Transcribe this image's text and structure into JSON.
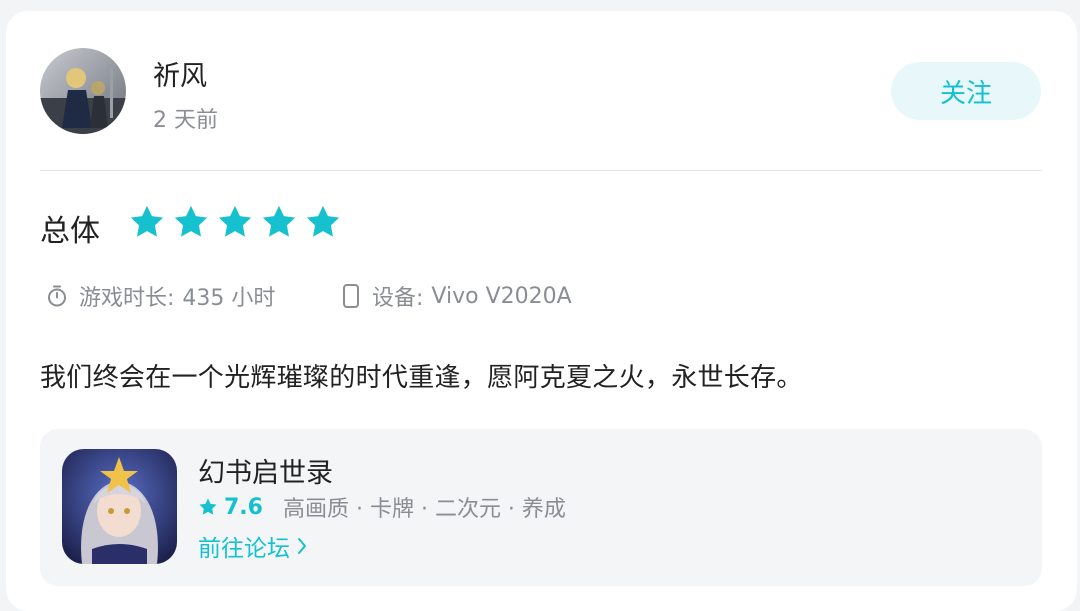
{
  "user": {
    "name": "祈风",
    "time": "2 天前"
  },
  "follow_label": "关注",
  "rating": {
    "label": "总体",
    "stars": 5,
    "star_color": "#15c1cf"
  },
  "meta": {
    "playtime_label": "游戏时长:",
    "playtime_value": "435 小时",
    "device_label": "设备:",
    "device_value": "Vivo V2020A"
  },
  "review_text": "我们终会在一个光辉璀璨的时代重逢，愿阿克夏之火，永世长存。",
  "game": {
    "title": "幻书启世录",
    "score": "7.6",
    "tags": "高画质 · 卡牌 · 二次元 · 养成",
    "forum_link": "前往论坛"
  },
  "colors": {
    "accent": "#15c1cf",
    "follow_bg": "#e8f7f9",
    "secondary_text": "#8a8d93"
  }
}
